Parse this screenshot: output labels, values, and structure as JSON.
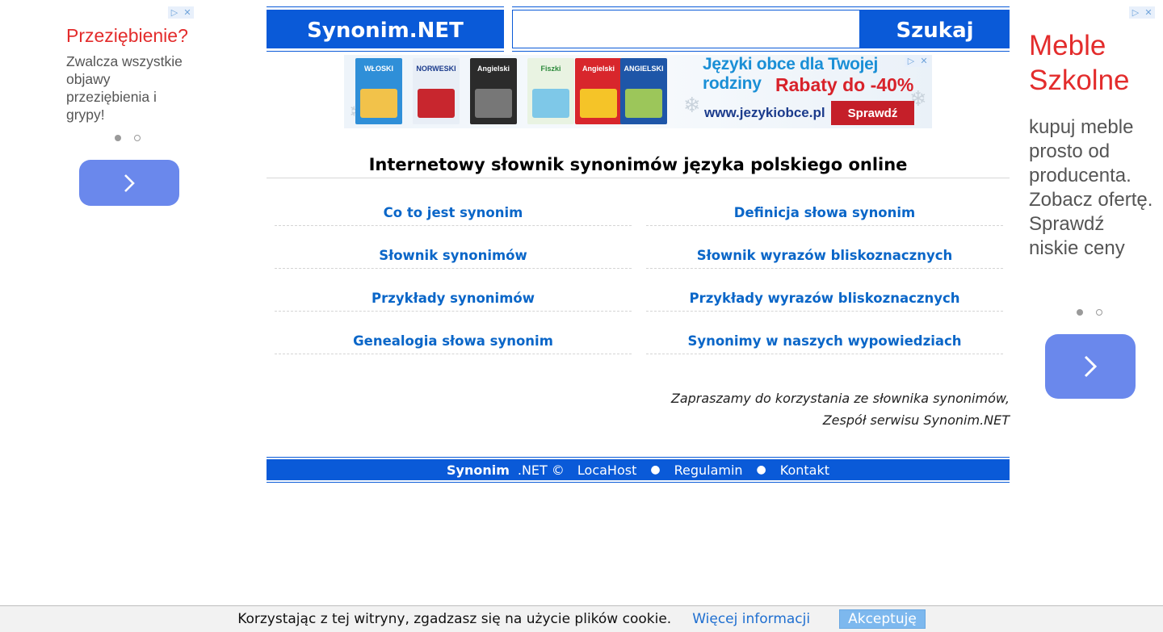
{
  "colors": {
    "brand_blue": "#0a5ad8",
    "link_blue": "#0a66c8",
    "ad_red": "#e32c2c",
    "ad_button": "#6a88ec"
  },
  "ad_left": {
    "title": "Przeziębienie?",
    "text": "Zwalcza wszystkie objawy przeziębienia i grypy!",
    "marker_info": "▷",
    "marker_close": "✕",
    "button_icon": "chevron-right-icon"
  },
  "ad_right": {
    "title": "Meble Szkolne",
    "text": "kupuj meble prosto od producenta. Zobacz ofertę. Sprawdź niskie ceny",
    "marker_info": "▷",
    "marker_close": "✕",
    "button_icon": "chevron-right-icon"
  },
  "header": {
    "logo": "Synonim.NET",
    "search_value": "",
    "search_button": "Szukaj"
  },
  "banner": {
    "books": [
      "WŁOSKI",
      "NORWESKI",
      "Angielski",
      "Fiszki",
      "Angielski",
      "ANGIELSKI"
    ],
    "headline": "Języki obce dla Twojej rodziny",
    "sale": "Rabaty do -40%",
    "url": "www.jezykiobce.pl",
    "cta": "Sprawdź",
    "marker_info": "▷",
    "marker_close": "✕"
  },
  "main": {
    "title": "Internetowy słownik synonimów języka polskiego online",
    "links": [
      "Co to jest synonim",
      "Definicja słowa synonim",
      "Słownik synonimów",
      "Słownik wyrazów bliskoznacznych",
      "Przykłady synonimów",
      "Przykłady wyrazów bliskoznacznych",
      "Genealogia słowa synonim",
      "Synonimy w naszych wypowiedziach"
    ],
    "invite_line1": "Zapraszamy do korzystania ze słownika synonimów,",
    "invite_line2": "Zespół serwisu Synonim.NET"
  },
  "footer": {
    "brand": "Synonim",
    "copyright": ".NET ©",
    "host": "LocaHost",
    "sep": "●",
    "terms": "Regulamin",
    "contact": "Kontakt"
  },
  "cookie": {
    "text": "Korzystając z tej witryny, zgadzasz się na użycie plików cookie.",
    "more": "Więcej informacji",
    "accept": "Akceptuję"
  }
}
